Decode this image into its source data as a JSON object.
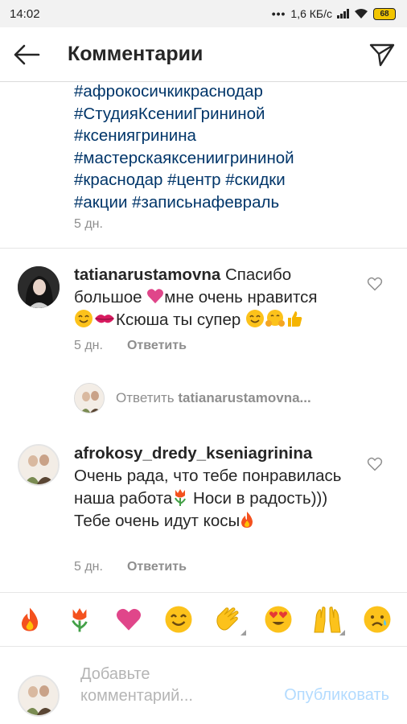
{
  "status_bar": {
    "time": "14:02",
    "network_speed": "1,6 КБ/с",
    "battery": "68"
  },
  "header": {
    "title": "Комментарии",
    "back_icon": "arrow-left-icon",
    "send_icon": "paper-plane-icon"
  },
  "caption": {
    "hashtag_lines": [
      "#афрокосичкикраснодар",
      "#СтудияКсенииГрининой",
      "#ксениягринина",
      "#мастерскаяксениигрининой",
      "#краснодар #центр #скидки",
      "#акции #записьнафевраль"
    ],
    "time": "5 дн."
  },
  "comments": [
    {
      "username": "tatianarustamovna",
      "text_part1": " Спасибо большое ",
      "text_part2": "мне очень нравится ",
      "text_part3": "Ксюша ты супер ",
      "time": "5 дн.",
      "reply_label": "Ответить",
      "emojis": [
        "pink-heart-icon",
        "smiling-face-icon",
        "kiss-mark-icon",
        "smiling-face-icon",
        "hugging-face-icon",
        "thumbs-up-icon"
      ]
    },
    {
      "username": "afrokosy_dredy_kseniagrinina",
      "text_part1": "Очень рада, что тебе понравилась наша работа",
      "text_part2": " Носи в радость))) Тебе очень идут косы",
      "time": "5 дн.",
      "reply_label": "Ответить",
      "emojis": [
        "tulip-icon",
        "fire-icon"
      ]
    }
  ],
  "reply_prompt": {
    "prefix": "Ответить ",
    "username": "tatianarustamovna..."
  },
  "emoji_bar": [
    "fire-icon",
    "tulip-icon",
    "pink-heart-icon",
    "smiling-face-icon",
    "clapping-hands-icon",
    "heart-eyes-icon",
    "raising-hands-icon",
    "sad-face-icon"
  ],
  "composer": {
    "placeholder": "Добавьте комментарий...",
    "publish_label": "Опубликовать"
  },
  "colors": {
    "hashtag": "#003569",
    "muted": "#8e8e8e",
    "publish": "#b3dbff",
    "heart_emoji": "#e0468a",
    "fire": "#f4511e"
  }
}
